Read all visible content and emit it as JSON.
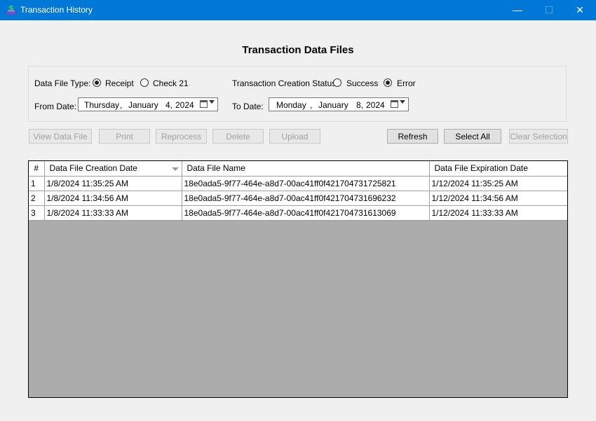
{
  "window": {
    "title": "Transaction History",
    "minimize": "—",
    "maximize": "☐",
    "close": "✕"
  },
  "heading": "Transaction Data Files",
  "filters": {
    "file_type_label": "Data File Type:",
    "file_type_options": [
      "Receipt",
      "Check 21"
    ],
    "file_type_selected": "Receipt",
    "status_label": "Transaction Creation Status:",
    "status_options": [
      "Success",
      "Error"
    ],
    "status_selected": "Error",
    "from_label": "From Date:",
    "from_date": {
      "weekday": "Thursday",
      "month": "January",
      "day": "4,",
      "year": "2024"
    },
    "to_label": "To Date:",
    "to_date": {
      "weekday": "Monday",
      "month": "January",
      "day": "8,",
      "year": "2024"
    }
  },
  "buttons": {
    "view": "View Data File",
    "print": "Print",
    "reprocess": "Reprocess",
    "delete": "Delete",
    "upload": "Upload",
    "refresh": "Refresh",
    "select_all": "Select All",
    "clear_selection": "Clear Selection"
  },
  "grid": {
    "columns": [
      "#",
      "Data File Creation Date",
      "Data File Name",
      "Data File Expiration Date"
    ],
    "rows": [
      [
        "1",
        "1/8/2024 11:35:25 AM",
        "18e0ada5-9f77-464e-a8d7-00ac41ff0f421704731725821",
        "1/12/2024 11:35:25 AM"
      ],
      [
        "2",
        "1/8/2024 11:34:56 AM",
        "18e0ada5-9f77-464e-a8d7-00ac41ff0f421704731696232",
        "1/12/2024 11:34:56 AM"
      ],
      [
        "3",
        "1/8/2024 11:33:33 AM",
        "18e0ada5-9f77-464e-a8d7-00ac41ff0f421704731613069",
        "1/12/2024 11:33:33 AM"
      ]
    ]
  },
  "colors": {
    "titlebar": "#0078d7",
    "grid_empty": "#ababab"
  },
  "icons": {
    "app": "dollar-app-icon",
    "calendar": "calendar-icon"
  }
}
